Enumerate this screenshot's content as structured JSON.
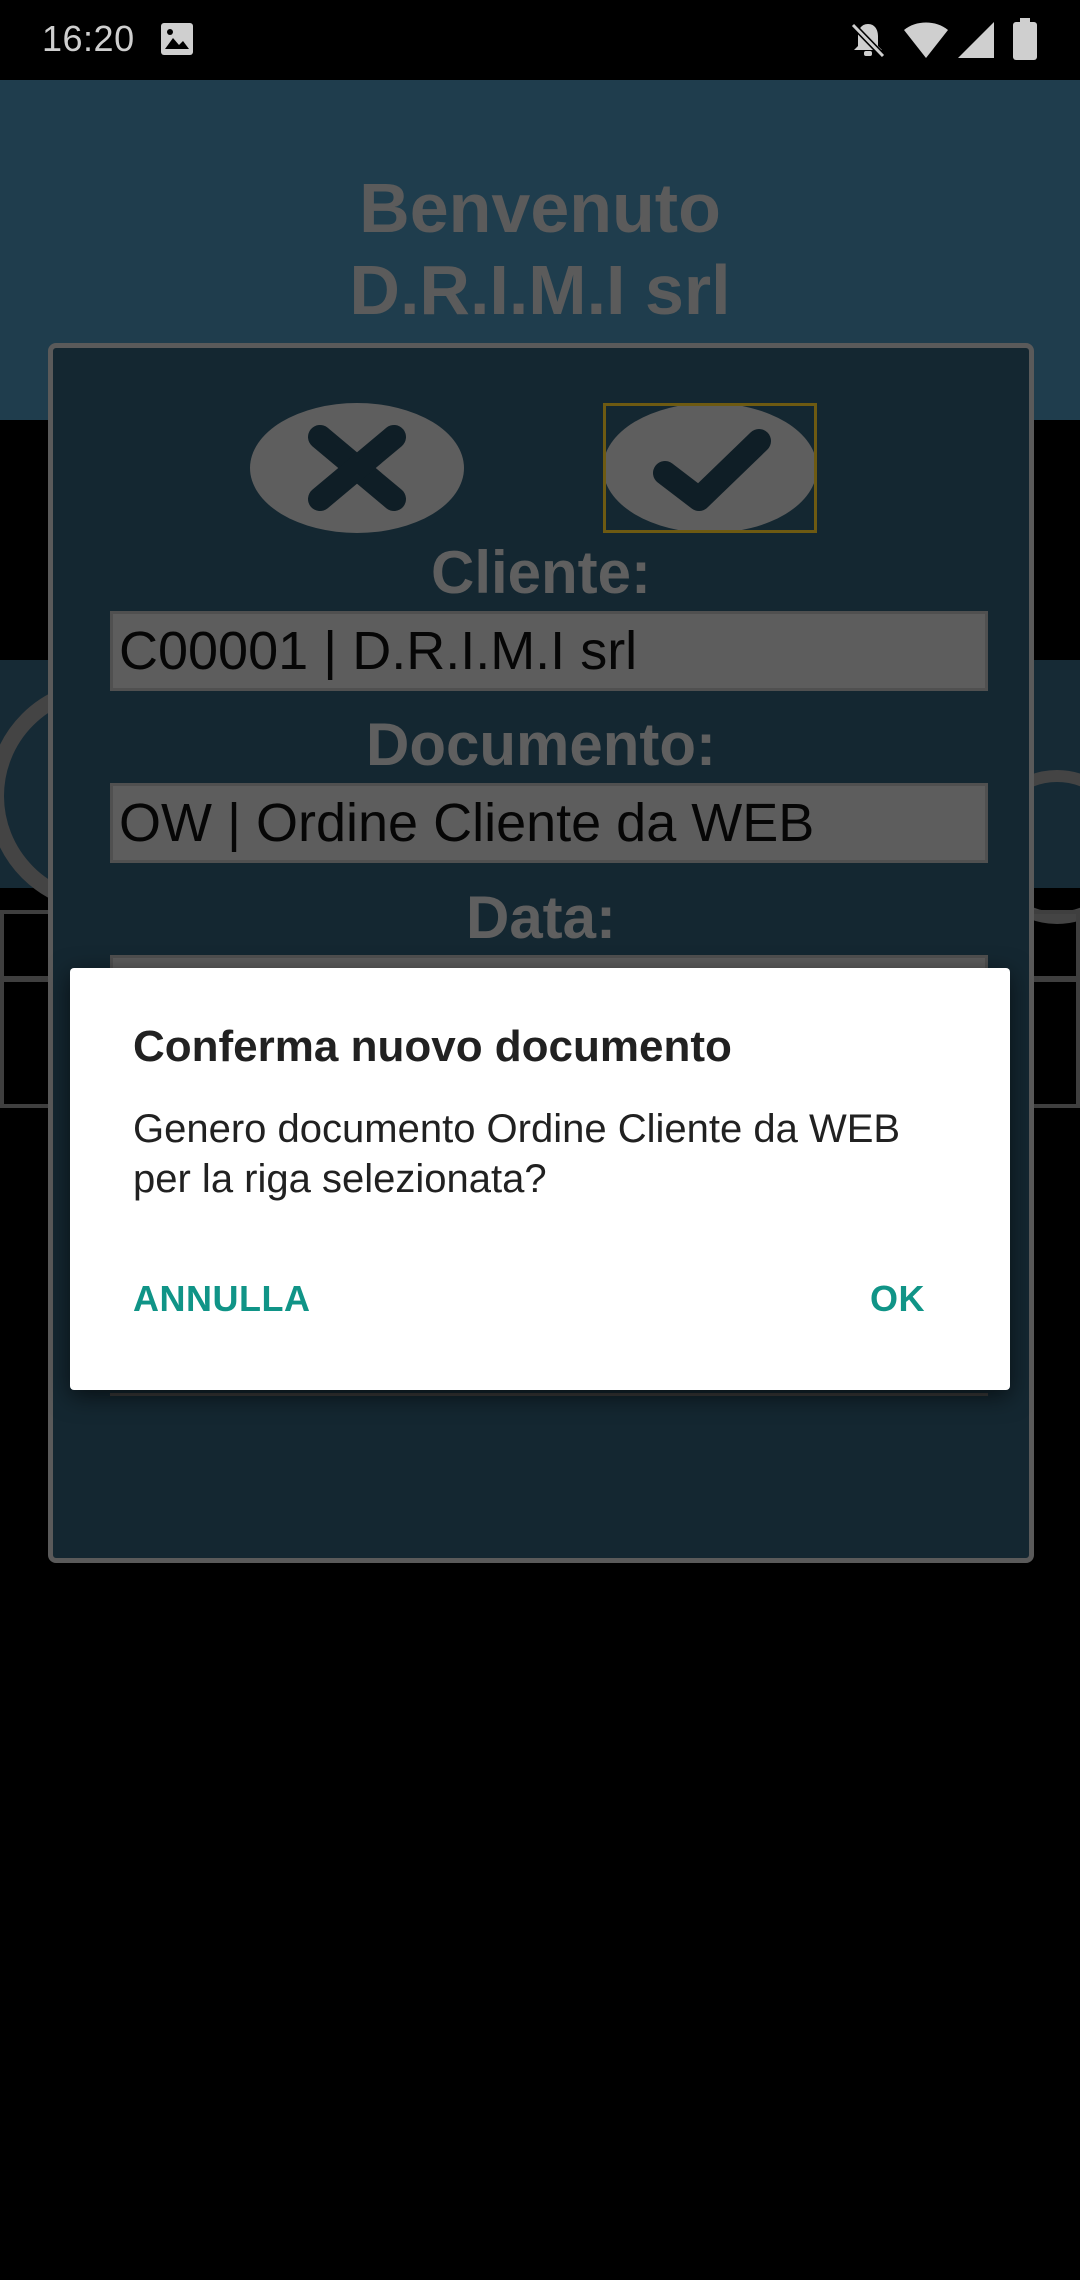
{
  "status_bar": {
    "time": "16:20",
    "icons": [
      "image-icon",
      "notifications-off-icon",
      "wifi-icon",
      "cell-signal-icon",
      "battery-icon"
    ]
  },
  "app": {
    "welcome_line1": "Benvenuto",
    "welcome_line2": "D.R.I.M.I srl"
  },
  "panel": {
    "cancel_icon": "close-icon",
    "confirm_icon": "check-icon",
    "cliente_label": "Cliente:",
    "cliente_value": "C00001 | D.R.I.M.I srl",
    "documento_label": "Documento:",
    "documento_value": "OW | Ordine Cliente da WEB",
    "data_label": "Data:"
  },
  "alert": {
    "title": "Conferma nuovo documento",
    "message": "Genero documento Ordine Cliente da WEB per la riga selezionata?",
    "cancel_label": "ANNULLA",
    "ok_label": "OK"
  },
  "colors": {
    "accent": "#109487",
    "header_bg": "#1f3d4d",
    "panel_bg": "#142731",
    "scrim": "#000000"
  }
}
